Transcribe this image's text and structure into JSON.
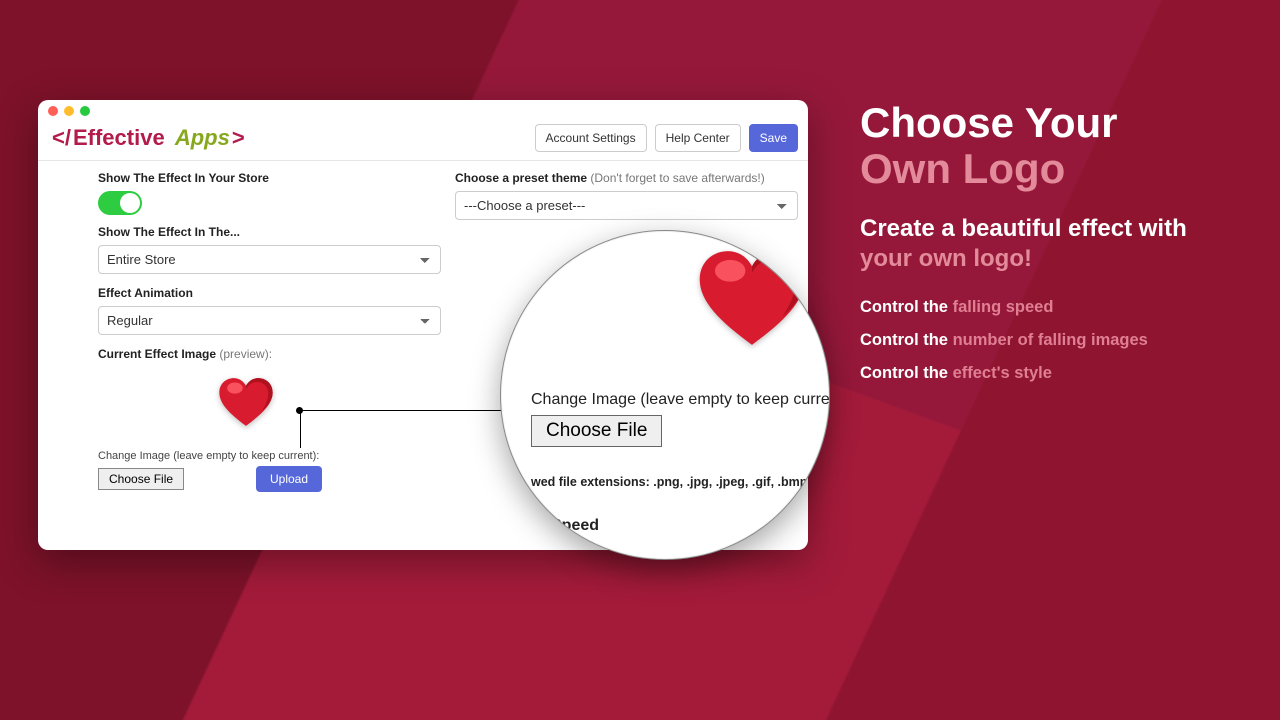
{
  "header": {
    "brand_left": "Effective",
    "brand_right": "Apps",
    "account_settings": "Account Settings",
    "help_center": "Help Center",
    "save": "Save"
  },
  "left": {
    "show_effect_store": "Show The Effect In Your Store",
    "toggle_on": true,
    "show_effect_in": "Show The Effect In The...",
    "show_effect_in_value": "Entire Store",
    "effect_animation": "Effect Animation",
    "effect_animation_value": "Regular",
    "current_image": "Current Effect Image",
    "current_image_hint": "(preview):",
    "change_image": "Change Image (leave empty to keep current):",
    "choose_file": "Choose File",
    "upload": "Upload"
  },
  "right": {
    "preset_label": "Choose a preset theme",
    "preset_hint": "(Don't forget to save afterwards!)",
    "preset_value": "---Choose a preset---"
  },
  "mag": {
    "change_image": "Change Image (leave empty to keep current)",
    "choose_file": "Choose File",
    "allowed": "wed file extensions: .png, .jpg, .jpeg, .gif, .bmp;",
    "speed": "Speed"
  },
  "promo": {
    "h1a": "Choose Your",
    "h1b": "Own Logo",
    "sub_a": "Create a beautiful effect with ",
    "sub_b": "your own logo!",
    "b1a": "Control the ",
    "b1b": "falling speed",
    "b2a": "Control the ",
    "b2b": "number of falling images",
    "b3a": "Control the ",
    "b3b": "effect's style"
  }
}
